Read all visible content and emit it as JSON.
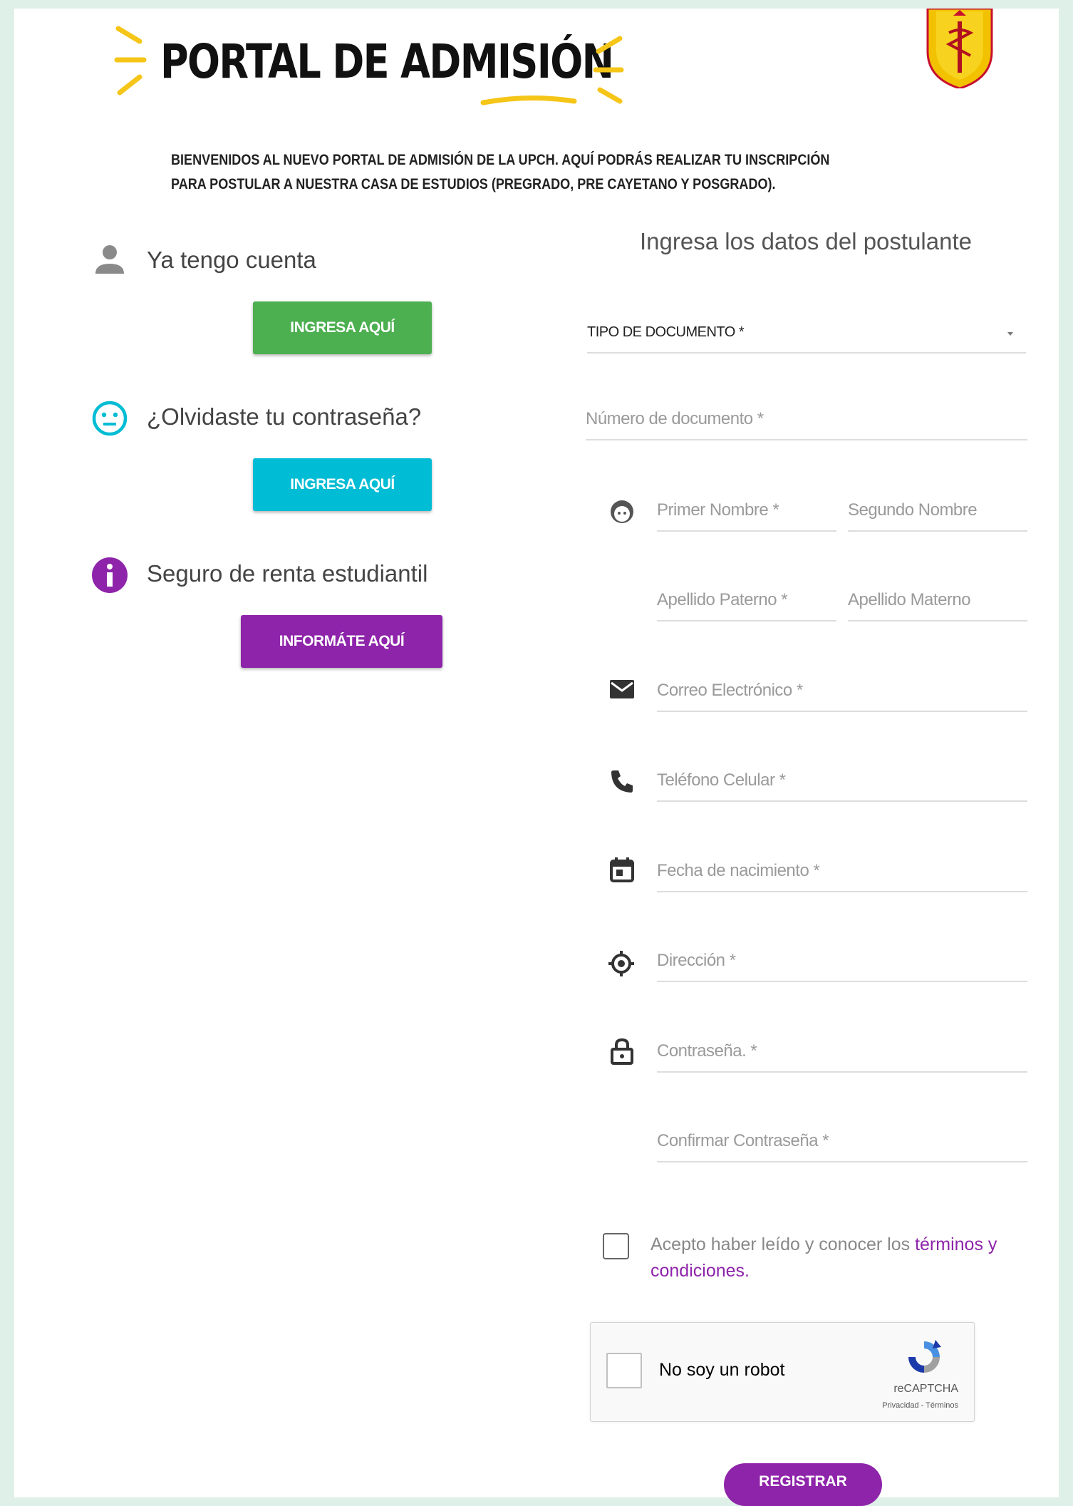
{
  "header": {
    "title": "PORTAL DE ADMISIÓN",
    "intro_line1": "BIENVENIDOS AL NUEVO PORTAL DE ADMISIÓN DE LA UPCH. AQUÍ PODRÁS REALIZAR TU INSCRIPCIÓN",
    "intro_line2": "PARA POSTULAR A NUESTRA CASA DE ESTUDIOS (PREGRADO, PRE CAYETANO Y POSGRADO)."
  },
  "left": {
    "account_label": "Ya tengo cuenta",
    "account_button": "INGRESA AQUÍ",
    "forgot_label": "¿Olvidaste tu contraseña?",
    "forgot_button": "INGRESA AQUÍ",
    "insurance_label": "Seguro de renta estudiantil",
    "insurance_button": "INFORMÁTE AQUÍ"
  },
  "form": {
    "title": "Ingresa los datos del postulante",
    "doc_type": "TIPO DE DOCUMENTO *",
    "doc_number": "Número de documento *",
    "first_name": "Primer Nombre *",
    "second_name": "Segundo Nombre",
    "paternal": "Apellido Paterno *",
    "maternal": "Apellido Materno",
    "email": "Correo Electrónico *",
    "phone": "Teléfono Celular *",
    "birth": "Fecha de nacimiento *",
    "address": "Dirección *",
    "password": "Contraseña. *",
    "confirm": "Confirmar Contraseña *",
    "terms_prefix": "Acepto haber leído y conocer los",
    "terms_link": "términos y condiciones.",
    "captcha_label": "No soy un robot",
    "captcha_brand": "reCAPTCHA",
    "captcha_links": "Privacidad - Términos",
    "submit": "REGISTRAR"
  },
  "colors": {
    "green": "#4caf50",
    "cyan": "#00bcd4",
    "purple": "#8e24aa",
    "background": "#dff0e8"
  }
}
